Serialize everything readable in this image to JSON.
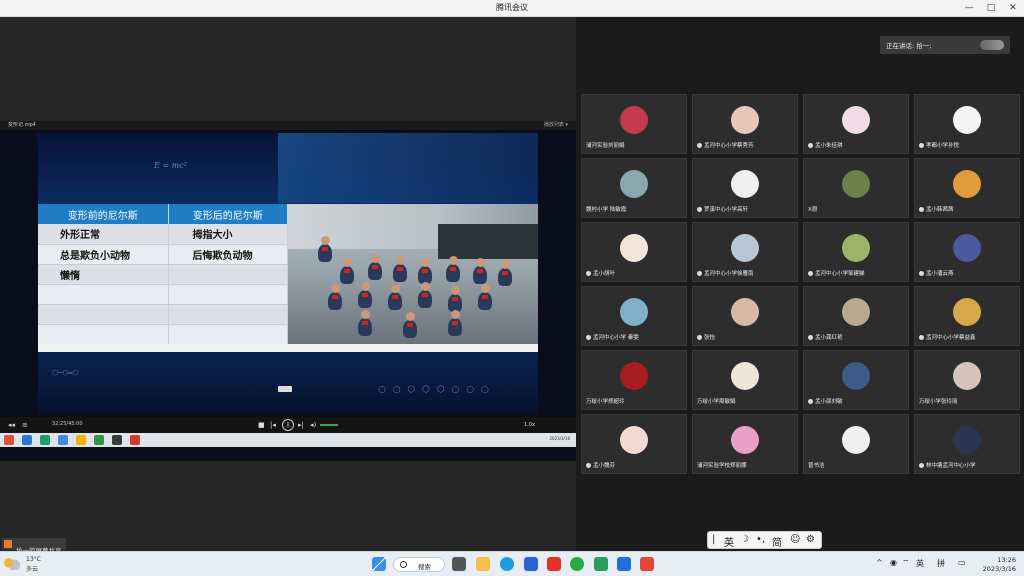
{
  "window": {
    "title": "腾讯会议",
    "controls": [
      "—",
      "□",
      "✕"
    ]
  },
  "video_player": {
    "filename": "变形记.mp4",
    "toolbar_text": "播放列表 ▾",
    "time": "32:25/45:00",
    "speed_label": "1.0x",
    "tray_text": "2023/3/16"
  },
  "slide": {
    "formula": "E = mc²",
    "table": {
      "headers": [
        "变形前的尼尔斯",
        "变形后的尼尔斯"
      ],
      "rows": [
        [
          "外形正常",
          "拇指大小"
        ],
        [
          "总是欺负小动物",
          "后悔欺负动物"
        ],
        [
          "懒惰",
          ""
        ],
        [
          "",
          ""
        ],
        [
          "",
          ""
        ],
        [
          "",
          ""
        ]
      ]
    }
  },
  "meeting": {
    "speaker_label": "正在讲话: 拾一;",
    "share_label": "拾一的屏幕共享",
    "participants": [
      {
        "name": "浦河实验刘丽娟",
        "mic": false,
        "avatar": "pink-flowers",
        "color": "#c23a4c"
      },
      {
        "name": "孟河中心小学蔡秀芳",
        "mic": true,
        "avatar": "girl-photo",
        "color": "#e9c7b8"
      },
      {
        "name": "孟小朱佳琪",
        "mic": true,
        "avatar": "cartoon-bunny",
        "color": "#f4d9e6"
      },
      {
        "name": "孝都小学孙悦",
        "mic": true,
        "avatar": "cartoon-cat",
        "color": "#f5f5f5"
      },
      {
        "name": "魏村小学 陆敏霞",
        "mic": false,
        "avatar": "anime-girl",
        "color": "#8aa6b0"
      },
      {
        "name": "罗溪中心小学高轩",
        "mic": true,
        "avatar": "cartoon-robot",
        "color": "#f0f0f0"
      },
      {
        "name": "X遐",
        "mic": false,
        "avatar": "nature-photo",
        "color": "#6f7f4a"
      },
      {
        "name": "孟小韩茜茜",
        "mic": true,
        "avatar": "cartoon-dog",
        "color": "#e39a3a"
      },
      {
        "name": "孟小胡叶",
        "mic": true,
        "avatar": "cartoon-fox",
        "color": "#f2e6d6"
      },
      {
        "name": "孟河中心小学徐雁南",
        "mic": true,
        "avatar": "child-photo",
        "color": "#b8c7d6"
      },
      {
        "name": "孟河中心小学邹建娣",
        "mic": true,
        "avatar": "plant-photo",
        "color": "#9cb46a"
      },
      {
        "name": "孟小潘云燕",
        "mic": true,
        "avatar": "sunset-photo",
        "color": "#4b5a9a"
      },
      {
        "name": "孟河中心小学 秦雯",
        "mic": true,
        "avatar": "sky-photo",
        "color": "#7fb0c8"
      },
      {
        "name": "张怡",
        "mic": true,
        "avatar": "girl-portrait",
        "color": "#d9b8a4"
      },
      {
        "name": "孟小龚红艳",
        "mic": true,
        "avatar": "texture-photo",
        "color": "#b9a88f"
      },
      {
        "name": "孟河中心小学蔡益鑫",
        "mic": true,
        "avatar": "cartoon-bear",
        "color": "#d6a84a"
      },
      {
        "name": "万绥小学郑超玲",
        "mic": false,
        "avatar": "red-flower",
        "color": "#a81c22"
      },
      {
        "name": "万绥小学周敏娟",
        "mic": false,
        "avatar": "cartoon-boy",
        "color": "#efe6d5"
      },
      {
        "name": "孟小邵刘敏",
        "mic": true,
        "avatar": "sea-photo",
        "color": "#3d5c8a"
      },
      {
        "name": "万绥小学张玲丽",
        "mic": false,
        "avatar": "hand-photo",
        "color": "#d5c3bb"
      },
      {
        "name": "孟小魏芬",
        "mic": true,
        "avatar": "cartoon-girl",
        "color": "#f3d9d2"
      },
      {
        "name": "浦河实验学校郑丽娜",
        "mic": false,
        "avatar": "pink-toy",
        "color": "#e8a0c6"
      },
      {
        "name": "曾书洁",
        "mic": false,
        "avatar": "sketch-photo",
        "color": "#f0f0f0"
      },
      {
        "name": "林中塘孟河中心小学",
        "mic": true,
        "avatar": "man-portrait",
        "color": "#2c3550"
      }
    ]
  },
  "ime": {
    "items": [
      "|",
      "英",
      "☽",
      "•,",
      "简",
      "☺",
      "⚙"
    ]
  },
  "taskbar": {
    "weather_temp": "13°C",
    "weather_cond": "多云",
    "search_label": "搜索",
    "tray_items": [
      "^",
      "英",
      "拼"
    ],
    "time": "13:26",
    "date": "2023/3/16"
  }
}
